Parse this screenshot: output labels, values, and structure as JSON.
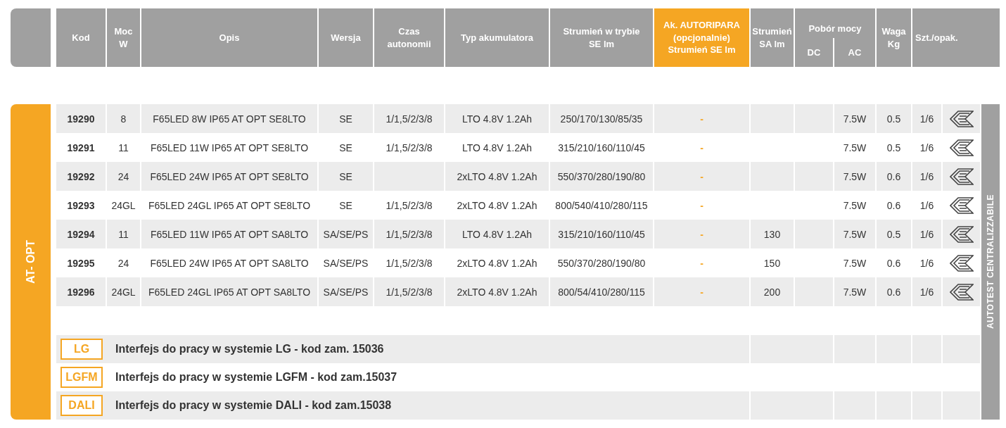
{
  "header": {
    "columns": [
      {
        "kind": "single",
        "label": "Kod",
        "highlighted": false
      },
      {
        "kind": "single",
        "label": "Moc\nW",
        "highlighted": false
      },
      {
        "kind": "single",
        "label": "Opis",
        "highlighted": false
      },
      {
        "kind": "single",
        "label": "Wersja",
        "highlighted": false
      },
      {
        "kind": "single",
        "label": "Czas\nautonomii",
        "highlighted": false
      },
      {
        "kind": "single",
        "label": "Typ akumulatora",
        "highlighted": false
      },
      {
        "kind": "single",
        "label": "Strumień w trybie\nSE lm",
        "highlighted": false
      },
      {
        "kind": "single",
        "label": "Ak. AUTORIPARA\n(opcjonalnie)\nStrumień SE lm",
        "highlighted": true
      },
      {
        "kind": "single",
        "label": "Strumień\nSA lm",
        "highlighted": false
      },
      {
        "kind": "group",
        "label": "Pobór mocy",
        "sub": [
          "DC",
          "AC"
        ],
        "highlighted": false
      },
      {
        "kind": "single",
        "label": "Waga\nKg",
        "highlighted": false
      },
      {
        "kind": "single",
        "label": "Szt./opak.",
        "highlighted": false
      }
    ]
  },
  "side_label": "AT- OPT",
  "vertical_label": "AUTOTEST CENTRALIZZABILE",
  "rows": [
    {
      "kod": "19290",
      "moc": "8",
      "opis": "F65LED 8W IP65 AT OPT SE8LTO",
      "wersja": "SE",
      "czas": "1/1,5/2/3/8",
      "typ": "LTO 4.8V 1.2Ah",
      "strumien_se": "250/170/130/85/35",
      "ak": "-",
      "ac": "7.5W",
      "waga": "0.5",
      "szt": "1/6"
    },
    {
      "kod": "19291",
      "moc": "11",
      "opis": "F65LED 11W IP65 AT OPT SE8LTO",
      "wersja": "SE",
      "czas": "1/1,5/2/3/8",
      "typ": "LTO 4.8V 1.2Ah",
      "strumien_se": "315/210/160/110/45",
      "ak": "-",
      "ac": "7.5W",
      "waga": "0.5",
      "szt": "1/6"
    },
    {
      "kod": "19292",
      "moc": "24",
      "opis": "F65LED 24W IP65 AT OPT SE8LTO",
      "wersja": "SE",
      "typ": "2xLTO 4.8V 1.2Ah",
      "strumien_se": "550/370/280/190/80",
      "ak": "-",
      "ac": "7.5W",
      "waga": "0.6",
      "szt": "1/6"
    },
    {
      "kod": "19293",
      "moc": "24GL",
      "opis": "F65LED 24GL IP65 AT OPT SE8LTO",
      "wersja": "SE",
      "czas": "1/1,5/2/3/8",
      "typ": "2xLTO 4.8V 1.2Ah",
      "strumien_se": "800/540/410/280/115",
      "ak": "-",
      "ac": "7.5W",
      "waga": "0.6",
      "szt": "1/6"
    },
    {
      "kod": "19294",
      "moc": "11",
      "opis": "F65LED 11W IP65 AT OPT SA8LTO",
      "wersja": "SA/SE/PS",
      "czas": "1/1,5/2/3/8",
      "typ": "LTO 4.8V 1.2Ah",
      "strumien_se": "315/210/160/110/45",
      "ak": "-",
      "strumien_sa": "130",
      "ac": "7.5W",
      "waga": "0.5",
      "szt": "1/6"
    },
    {
      "kod": "19295",
      "moc": "24",
      "opis": "F65LED 24W IP65 AT OPT SA8LTO",
      "wersja": "SA/SE/PS",
      "czas": "1/1,5/2/3/8",
      "typ": "2xLTO 4.8V 1.2Ah",
      "strumien_se": "550/370/280/190/80",
      "ak": "-",
      "strumien_sa": "150",
      "ac": "7.5W",
      "waga": "0.6",
      "szt": "1/6"
    },
    {
      "kod": "19296",
      "moc": "24GL",
      "opis": "F65LED 24GL IP65 AT OPT SA8LTO",
      "wersja": "SA/SE/PS",
      "czas": "1/1,5/2/3/8",
      "typ": "2xLTO 4.8V 1.2Ah",
      "strumien_se": "800/54/410/280/115",
      "ak": "-",
      "strumien_sa": "200",
      "ac": "7.5W",
      "waga": "0.6",
      "szt": "1/6"
    }
  ],
  "interfaces": [
    {
      "badge": "LG",
      "text": "Interfejs do pracy w systemie LG - kod zam. 15036"
    },
    {
      "badge": "LGFM",
      "text": "Interfejs do pracy w systemie LGFM - kod zam.15037"
    },
    {
      "badge": "DALI",
      "text": "Interfejs do pracy w systemie DALI - kod zam.15038"
    }
  ]
}
